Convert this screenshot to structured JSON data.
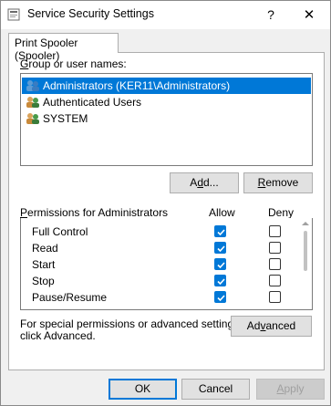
{
  "window": {
    "title": "Service Security Settings",
    "help_glyph": "?",
    "close_glyph": "✕"
  },
  "tab": {
    "label": "Print Spooler (Spooler)"
  },
  "users": {
    "label_prefix": "",
    "label_accel": "G",
    "label_rest": "roup or user names:",
    "items": [
      {
        "name": "Administrators (KER11\\Administrators)",
        "selected": true
      },
      {
        "name": "Authenticated Users",
        "selected": false
      },
      {
        "name": "SYSTEM",
        "selected": false
      }
    ]
  },
  "buttons": {
    "add_pre": "A",
    "add_accel": "d",
    "add_post": "d...",
    "remove_pre": "",
    "remove_accel": "R",
    "remove_post": "emove",
    "advanced_pre": "Ad",
    "advanced_accel": "v",
    "advanced_post": "anced",
    "ok": "OK",
    "cancel": "Cancel",
    "apply_pre": "",
    "apply_accel": "A",
    "apply_post": "pply"
  },
  "permissions": {
    "label_accel": "P",
    "label_rest": "ermissions for Administrators",
    "allow_header": "Allow",
    "deny_header": "Deny",
    "rows": [
      {
        "name": "Full Control",
        "allow": true,
        "deny": false
      },
      {
        "name": "Read",
        "allow": true,
        "deny": false
      },
      {
        "name": "Start",
        "allow": true,
        "deny": false
      },
      {
        "name": "Stop",
        "allow": true,
        "deny": false
      },
      {
        "name": "Pause/Resume",
        "allow": true,
        "deny": false
      }
    ]
  },
  "special": {
    "line1": "For special permissions or advanced settings,",
    "line2": "click Advanced."
  },
  "colors": {
    "accent": "#0078d7",
    "window_bg": "#f0f0f0"
  }
}
